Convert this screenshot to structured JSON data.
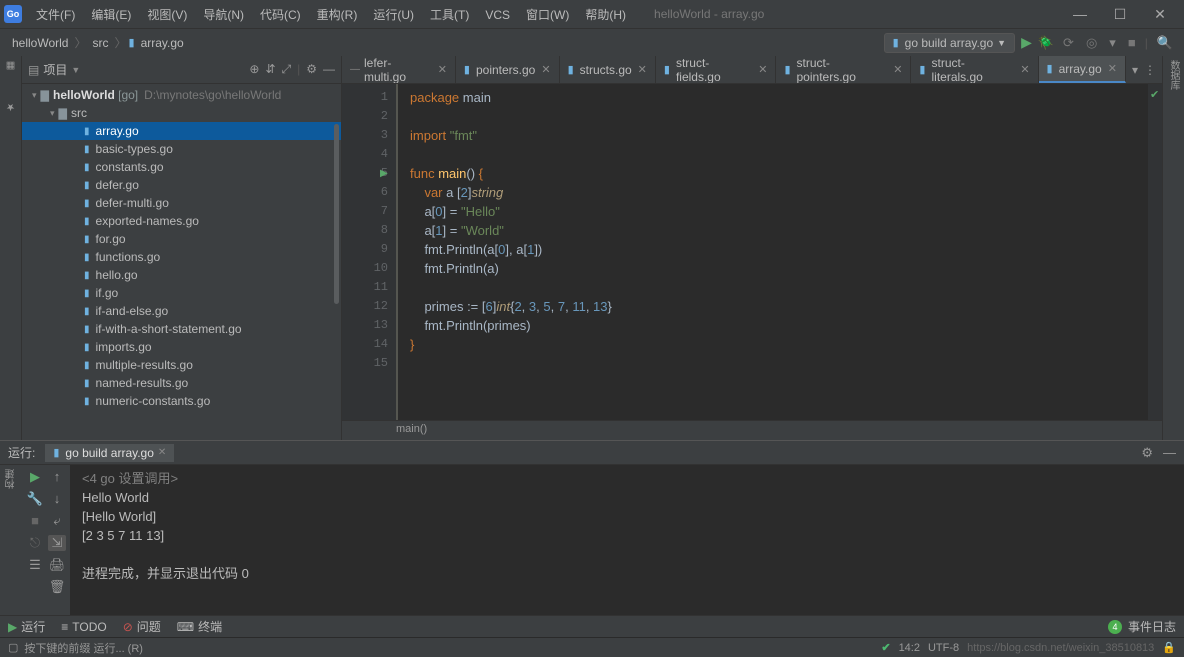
{
  "menu": [
    "文件(F)",
    "编辑(E)",
    "视图(V)",
    "导航(N)",
    "代码(C)",
    "重构(R)",
    "运行(U)",
    "工具(T)",
    "VCS",
    "窗口(W)",
    "帮助(H)"
  ],
  "window_title": "helloWorld - array.go",
  "breadcrumbs": {
    "project": "helloWorld",
    "folder": "src",
    "file": "array.go"
  },
  "build_config": "go build array.go",
  "project_panel_label": "项目",
  "project": {
    "name": "helloWorld",
    "tag": "[go]",
    "path": "D:\\mynotes\\go\\helloWorld"
  },
  "src_folder": "src",
  "files": [
    "array.go",
    "basic-types.go",
    "constants.go",
    "defer.go",
    "defer-multi.go",
    "exported-names.go",
    "for.go",
    "functions.go",
    "hello.go",
    "if.go",
    "if-and-else.go",
    "if-with-a-short-statement.go",
    "imports.go",
    "multiple-results.go",
    "named-results.go",
    "numeric-constants.go"
  ],
  "selected_file": "array.go",
  "tabs": [
    {
      "name": "lefer-multi.go",
      "split": true
    },
    {
      "name": "pointers.go"
    },
    {
      "name": "structs.go"
    },
    {
      "name": "struct-fields.go"
    },
    {
      "name": "struct-pointers.go"
    },
    {
      "name": "struct-literals.go"
    },
    {
      "name": "array.go",
      "active": true
    }
  ],
  "line_count": 15,
  "code_lines": [
    [
      {
        "t": "package ",
        "c": "kw"
      },
      {
        "t": "main",
        "c": "op"
      }
    ],
    [],
    [
      {
        "t": "import ",
        "c": "kw"
      },
      {
        "t": "\"fmt\"",
        "c": "str"
      }
    ],
    [],
    [
      {
        "t": "func ",
        "c": "kw"
      },
      {
        "t": "main",
        "c": "fn"
      },
      {
        "t": "() ",
        "c": "op"
      },
      {
        "t": "{",
        "c": "brace"
      }
    ],
    [
      {
        "t": "    ",
        "c": "op"
      },
      {
        "t": "var ",
        "c": "kw"
      },
      {
        "t": "a [",
        "c": "op"
      },
      {
        "t": "2",
        "c": "num"
      },
      {
        "t": "]",
        "c": "op"
      },
      {
        "t": "string",
        "c": "typ"
      }
    ],
    [
      {
        "t": "    a[",
        "c": "op"
      },
      {
        "t": "0",
        "c": "num"
      },
      {
        "t": "] = ",
        "c": "op"
      },
      {
        "t": "\"Hello\"",
        "c": "str"
      }
    ],
    [
      {
        "t": "    a[",
        "c": "op"
      },
      {
        "t": "1",
        "c": "num"
      },
      {
        "t": "] = ",
        "c": "op"
      },
      {
        "t": "\"World\"",
        "c": "str"
      }
    ],
    [
      {
        "t": "    fmt.Println(a[",
        "c": "op"
      },
      {
        "t": "0",
        "c": "num"
      },
      {
        "t": "]",
        "c": "op"
      },
      {
        "t": ", ",
        "c": "op"
      },
      {
        "t": "a[",
        "c": "op"
      },
      {
        "t": "1",
        "c": "num"
      },
      {
        "t": "])",
        "c": "op"
      }
    ],
    [
      {
        "t": "    fmt.Println(a)",
        "c": "op"
      }
    ],
    [],
    [
      {
        "t": "    primes := [",
        "c": "op"
      },
      {
        "t": "6",
        "c": "num"
      },
      {
        "t": "]",
        "c": "op"
      },
      {
        "t": "int",
        "c": "typ"
      },
      {
        "t": "{",
        "c": "op"
      },
      {
        "t": "2",
        "c": "num"
      },
      {
        "t": ", ",
        "c": "op"
      },
      {
        "t": "3",
        "c": "num"
      },
      {
        "t": ", ",
        "c": "op"
      },
      {
        "t": "5",
        "c": "num"
      },
      {
        "t": ", ",
        "c": "op"
      },
      {
        "t": "7",
        "c": "num"
      },
      {
        "t": ", ",
        "c": "op"
      },
      {
        "t": "11",
        "c": "num"
      },
      {
        "t": ", ",
        "c": "op"
      },
      {
        "t": "13",
        "c": "num"
      },
      {
        "t": "}",
        "c": "op"
      }
    ],
    [
      {
        "t": "    fmt.Println(primes)",
        "c": "op"
      }
    ],
    [
      {
        "t": "}",
        "c": "brace"
      }
    ],
    []
  ],
  "fn_breadcrumb": "main()",
  "run_label": "运行:",
  "run_tab": "go build array.go",
  "run_config_line": "<4 go 设置调用>",
  "console_out": [
    "Hello World",
    "[Hello World]",
    "[2 3 5 7 11 13]",
    "",
    "进程完成，并显示退出代码 0"
  ],
  "bottom_tools": {
    "run": "运行",
    "todo": "TODO",
    "problems": "问题",
    "terminal": "终端"
  },
  "event_log": "事件日志",
  "event_badge": "4",
  "hint": "按下键的前缀 运行... (R)",
  "cursor": "14:2",
  "encoding": "UTF-8",
  "watermark": "https://blog.csdn.net/weixin_38510813"
}
